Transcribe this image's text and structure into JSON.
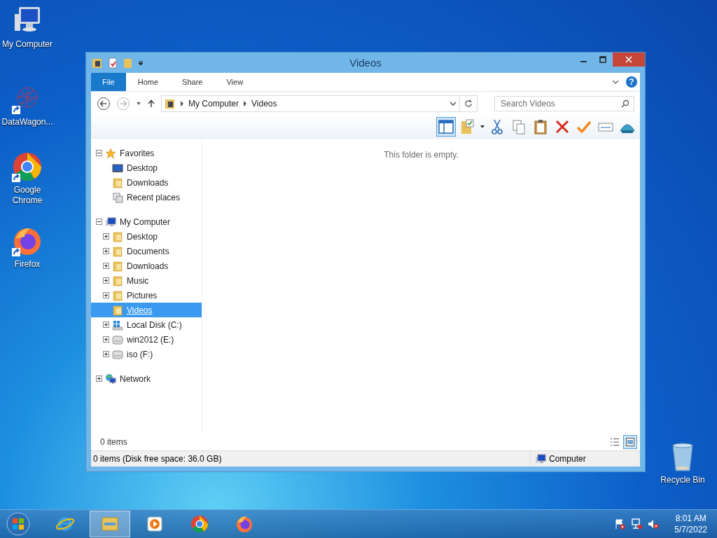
{
  "desktop_icons": [
    {
      "label": "My Computer",
      "kind": "computer",
      "shortcut": false
    },
    {
      "label": "DataWagon...",
      "kind": "network-graph",
      "shortcut": true
    },
    {
      "label": "Google Chrome",
      "kind": "chrome",
      "shortcut": true
    },
    {
      "label": "Firefox",
      "kind": "firefox",
      "shortcut": true
    }
  ],
  "recycle_bin": {
    "label": "Recycle Bin"
  },
  "window": {
    "title": "Videos",
    "ribbon_tabs": [
      {
        "label": "File",
        "kind": "file",
        "selected": false
      },
      {
        "label": "Home",
        "kind": "tab",
        "selected": false
      },
      {
        "label": "Share",
        "kind": "tab",
        "selected": false
      },
      {
        "label": "View",
        "kind": "tab",
        "selected": false
      }
    ],
    "help_glyph": "?",
    "breadcrumbs": [
      "My Computer",
      "Videos"
    ],
    "search": {
      "placeholder": "Search Videos"
    },
    "toolbar_buttons": [
      {
        "kind": "pane",
        "selected": true
      },
      {
        "kind": "folder-check",
        "selected": false
      },
      {
        "kind": "cut",
        "selected": false
      },
      {
        "kind": "copy",
        "selected": false
      },
      {
        "kind": "paste",
        "selected": false
      },
      {
        "kind": "delete",
        "selected": false
      },
      {
        "kind": "check",
        "selected": false
      },
      {
        "kind": "rename",
        "selected": false
      },
      {
        "kind": "shell",
        "selected": false
      }
    ],
    "nav_sections": [
      {
        "label": "Favorites",
        "kind": "star",
        "expanded": true,
        "selected": false,
        "children": [
          {
            "label": "Desktop",
            "kind": "desktop",
            "selected": false
          },
          {
            "label": "Downloads",
            "kind": "folder",
            "selected": false
          },
          {
            "label": "Recent places",
            "kind": "recent",
            "selected": false
          }
        ]
      },
      {
        "label": "My Computer",
        "kind": "computer",
        "expanded": true,
        "selected": false,
        "children": [
          {
            "label": "Desktop",
            "kind": "folder",
            "expanded": false,
            "selected": false
          },
          {
            "label": "Documents",
            "kind": "folder",
            "expanded": false,
            "selected": false
          },
          {
            "label": "Downloads",
            "kind": "folder",
            "expanded": false,
            "selected": false
          },
          {
            "label": "Music",
            "kind": "folder",
            "expanded": false,
            "selected": false
          },
          {
            "label": "Pictures",
            "kind": "folder",
            "expanded": false,
            "selected": false
          },
          {
            "label": "Videos",
            "kind": "folder",
            "selected": true
          },
          {
            "label": "Local Disk (C:)",
            "kind": "system-drive",
            "expanded": false,
            "selected": false
          },
          {
            "label": "win2012 (E:)",
            "kind": "drive",
            "expanded": false,
            "selected": false
          },
          {
            "label": "iso (F:)",
            "kind": "drive",
            "expanded": false,
            "selected": false
          }
        ]
      },
      {
        "label": "Network",
        "kind": "network",
        "expanded": false,
        "selected": false
      }
    ],
    "empty_message": "This folder is empty.",
    "item_count": "0 items",
    "view_buttons": [
      {
        "kind": "details",
        "selected": false
      },
      {
        "kind": "thumbnails",
        "selected": true
      }
    ],
    "status_bar": {
      "left": "0 items (Disk free space: 36.0 GB)",
      "right": "Computer"
    }
  },
  "taskbar": {
    "apps": [
      {
        "kind": "ie",
        "selected": false
      },
      {
        "kind": "explorer",
        "selected": true
      },
      {
        "kind": "media",
        "selected": false
      },
      {
        "kind": "chrome",
        "selected": false
      },
      {
        "kind": "firefox",
        "selected": false
      }
    ],
    "time": "8:01 AM",
    "date": "5/7/2022"
  }
}
